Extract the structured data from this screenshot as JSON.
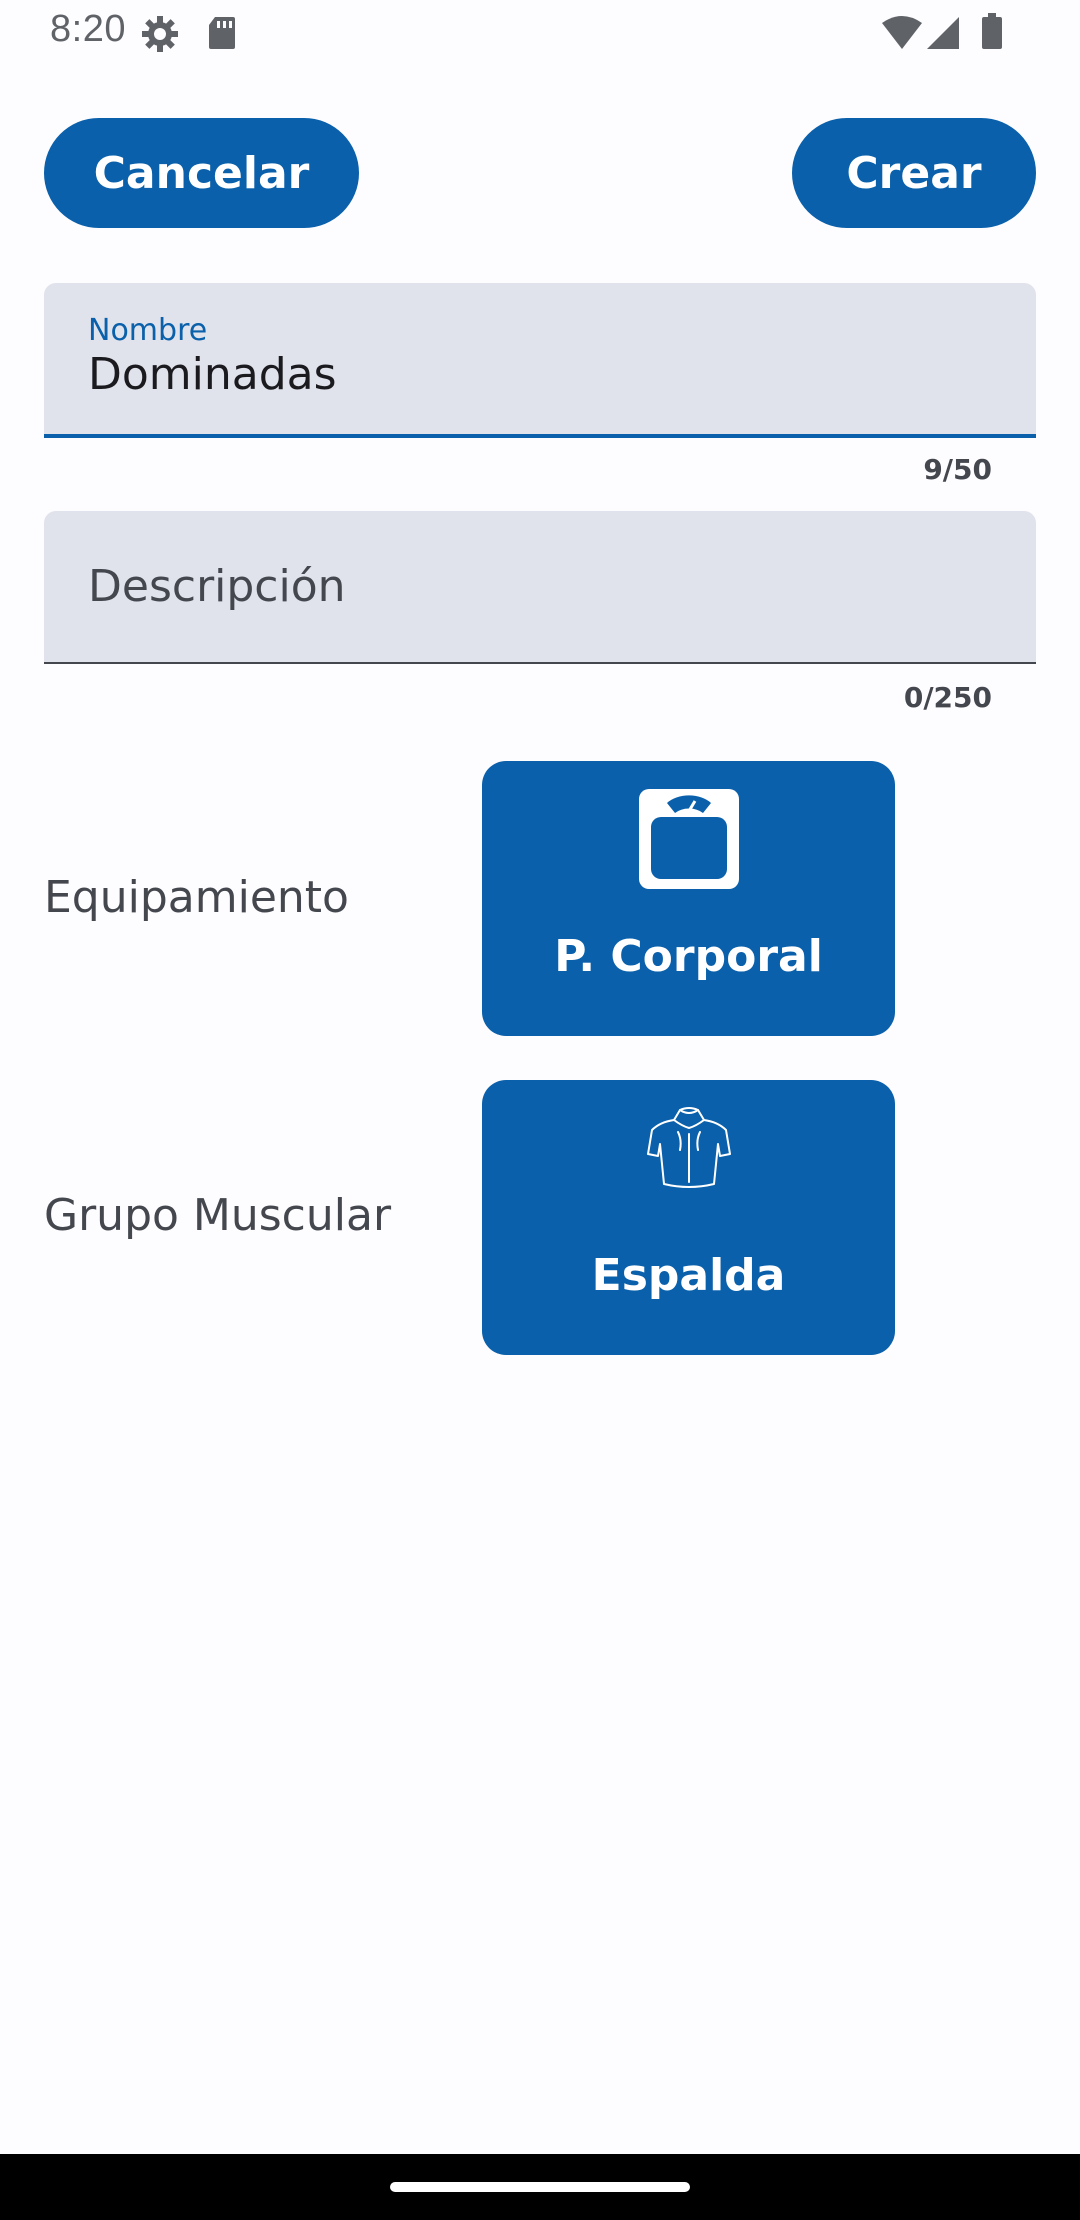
{
  "status_bar": {
    "time": "8:20",
    "icons": [
      "gear-icon",
      "sd-card-icon",
      "wifi-icon",
      "signal-icon",
      "battery-icon"
    ]
  },
  "header": {
    "cancel_label": "Cancelar",
    "create_label": "Crear"
  },
  "form": {
    "name": {
      "label": "Nombre",
      "value": "Dominadas",
      "counter": "9/50"
    },
    "description": {
      "placeholder": "Descripción",
      "counter": "0/250"
    },
    "equipment": {
      "label": "Equipamiento",
      "selected": "P. Corporal",
      "icon": "scale-icon"
    },
    "muscle_group": {
      "label": "Grupo Muscular",
      "selected": "Espalda",
      "icon": "back-muscles-icon"
    }
  },
  "colors": {
    "primary": "#0A60AA",
    "field_background": "#E0E2EC",
    "background": "#FDFCFF",
    "text_secondary": "#44474E"
  }
}
